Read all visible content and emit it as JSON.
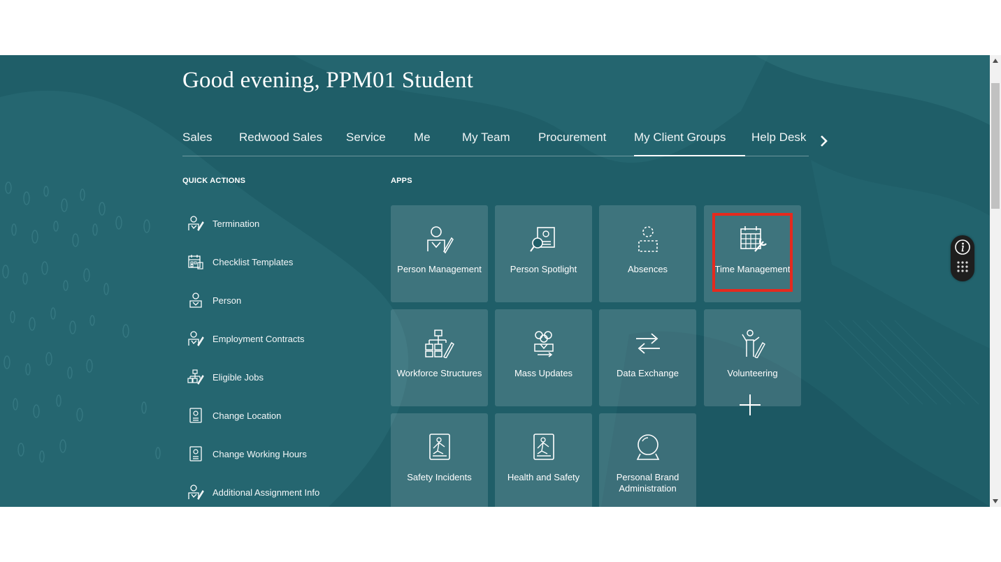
{
  "greeting": "Good evening, PPM01 Student",
  "nav": {
    "tabs": [
      "Sales",
      "Redwood Sales",
      "Service",
      "Me",
      "My Team",
      "Procurement",
      "My Client Groups",
      "Help Desk"
    ],
    "active": "My Client Groups",
    "next_icon": "chevron-right-icon"
  },
  "quick_actions": {
    "heading": "QUICK ACTIONS",
    "items": [
      {
        "label": "Termination",
        "icon": "person-edit-icon"
      },
      {
        "label": "Checklist Templates",
        "icon": "calendar-checklist-icon"
      },
      {
        "label": "Person",
        "icon": "person-badge-icon"
      },
      {
        "label": "Employment Contracts",
        "icon": "person-edit-icon"
      },
      {
        "label": "Eligible Jobs",
        "icon": "org-edit-icon"
      },
      {
        "label": "Change Location",
        "icon": "id-card-icon"
      },
      {
        "label": "Change Working Hours",
        "icon": "id-card-icon"
      },
      {
        "label": "Additional Assignment Info",
        "icon": "person-edit-icon"
      }
    ]
  },
  "apps": {
    "heading": "APPS",
    "tiles": [
      {
        "label": "Person Management",
        "icon": "person-edit-icon"
      },
      {
        "label": "Person Spotlight",
        "icon": "person-spotlight-icon"
      },
      {
        "label": "Absences",
        "icon": "absent-person-icon"
      },
      {
        "label": "Time Management",
        "icon": "calendar-wrench-icon"
      },
      {
        "label": "Workforce Structures",
        "icon": "org-chart-edit-icon"
      },
      {
        "label": "Mass Updates",
        "icon": "group-update-icon"
      },
      {
        "label": "Data Exchange",
        "icon": "exchange-arrows-icon"
      },
      {
        "label": "Volunteering",
        "icon": "volunteer-icon"
      },
      {
        "label": "Safety Incidents",
        "icon": "safety-incident-icon"
      },
      {
        "label": "Health and Safety",
        "icon": "health-safety-icon"
      },
      {
        "label": "Personal Brand Administration",
        "icon": "crystal-ball-icon"
      }
    ],
    "add_icon": "plus-icon",
    "highlighted": "Time Management"
  },
  "colors": {
    "background": "#1f5e68",
    "tile": "rgba(255,255,255,0.14)",
    "highlight": "#e52a1e",
    "text": "#ffffff"
  },
  "helper_widget": {
    "icons": [
      "info-icon",
      "grid-dots-icon"
    ]
  }
}
